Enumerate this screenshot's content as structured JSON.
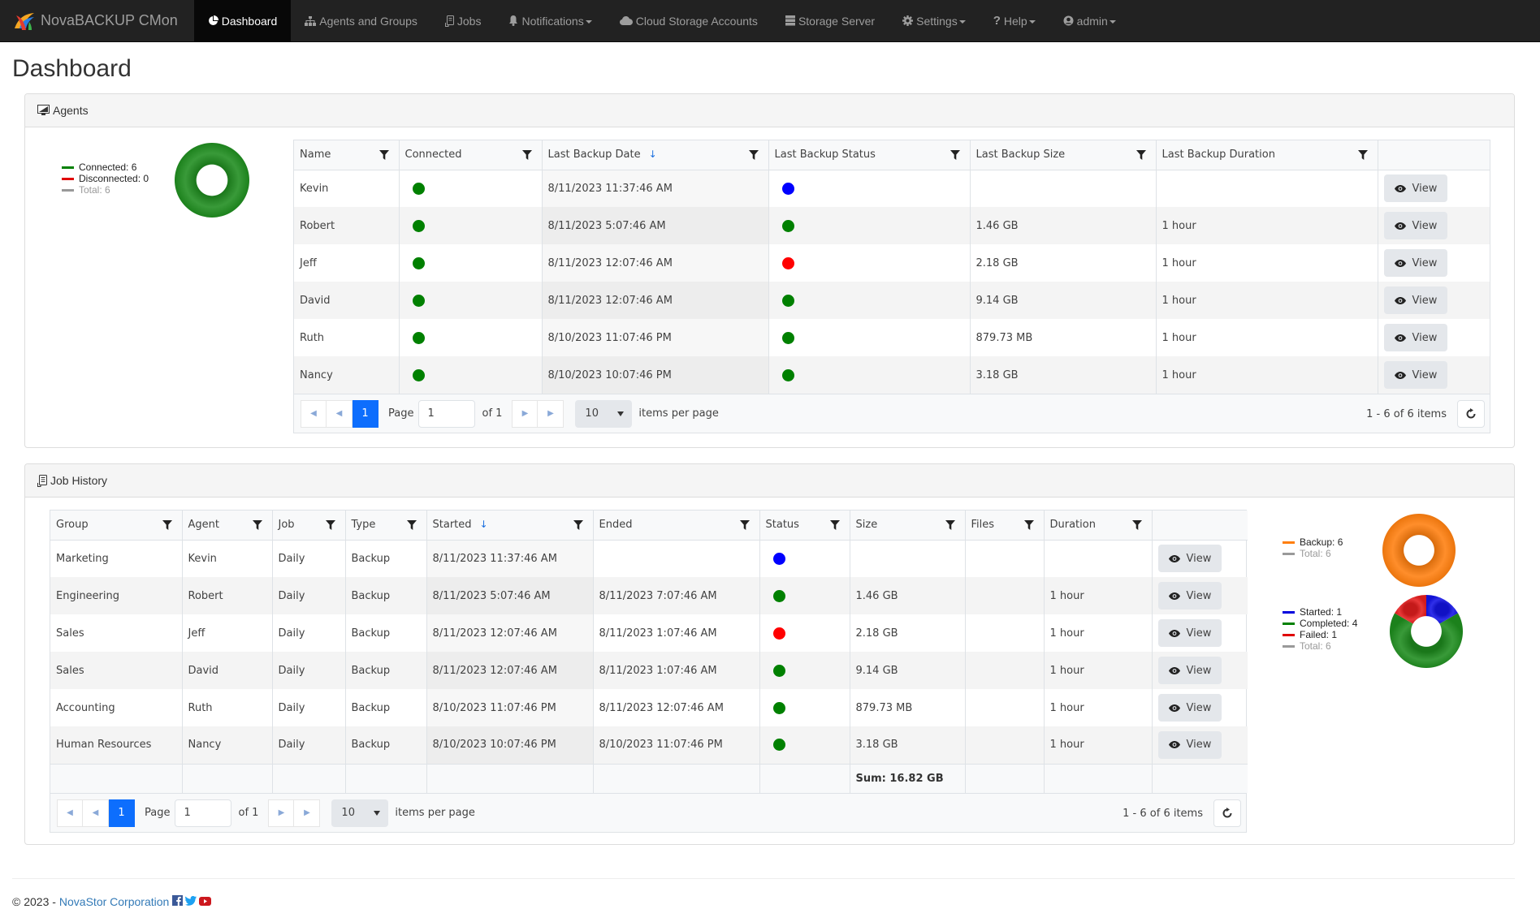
{
  "app": {
    "brand": "NovaBACKUP CMon"
  },
  "nav": {
    "items": [
      {
        "label": "Dashboard",
        "icon": "pie-chart-icon",
        "active": true
      },
      {
        "label": "Agents and Groups",
        "icon": "sitemap-icon"
      },
      {
        "label": "Jobs",
        "icon": "scroll-icon"
      },
      {
        "label": "Notifications",
        "icon": "bell-icon",
        "dropdown": true
      },
      {
        "label": "Cloud Storage Accounts",
        "icon": "cloud-icon"
      },
      {
        "label": "Storage Server",
        "icon": "server-icon"
      },
      {
        "label": "Settings",
        "icon": "gear-icon",
        "dropdown": true
      },
      {
        "label": "Help",
        "icon": "question-icon",
        "dropdown": true
      },
      {
        "label": "admin",
        "icon": "user-circle-icon",
        "dropdown": true
      }
    ]
  },
  "page": {
    "title": "Dashboard"
  },
  "agents": {
    "panel_title": "Agents",
    "chart": {
      "legend": [
        {
          "label": "Connected: 6",
          "color": "#008000"
        },
        {
          "label": "Disconnected: 0",
          "color": "#e00000"
        },
        {
          "label": "Total: 6",
          "color": "#999999"
        }
      ],
      "slices": [
        {
          "name": "Connected",
          "value": 6,
          "color": "#1e8c1e"
        },
        {
          "name": "Disconnected",
          "value": 0,
          "color": "#e02020"
        }
      ]
    },
    "columns": [
      "Name",
      "Connected",
      "Last Backup Date",
      "Last Backup Status",
      "Last Backup Size",
      "Last Backup Duration",
      ""
    ],
    "sorted_column": "Last Backup Date",
    "rows": [
      {
        "name": "Kevin",
        "connected": "green",
        "date": "8/11/2023 11:37:46 AM",
        "status": "blue",
        "size": "",
        "duration": ""
      },
      {
        "name": "Robert",
        "connected": "green",
        "date": "8/11/2023 5:07:46 AM",
        "status": "green",
        "size": "1.46 GB",
        "duration": "1 hour"
      },
      {
        "name": "Jeff",
        "connected": "green",
        "date": "8/11/2023 12:07:46 AM",
        "status": "red",
        "size": "2.18 GB",
        "duration": "1 hour"
      },
      {
        "name": "David",
        "connected": "green",
        "date": "8/11/2023 12:07:46 AM",
        "status": "green",
        "size": "9.14 GB",
        "duration": "1 hour"
      },
      {
        "name": "Ruth",
        "connected": "green",
        "date": "8/10/2023 11:07:46 PM",
        "status": "green",
        "size": "879.73 MB",
        "duration": "1 hour"
      },
      {
        "name": "Nancy",
        "connected": "green",
        "date": "8/10/2023 10:07:46 PM",
        "status": "green",
        "size": "3.18 GB",
        "duration": "1 hour"
      }
    ],
    "view_label": "View",
    "pager": {
      "current_page": "1",
      "page_label": "Page",
      "page_input": "1",
      "of_label": "of 1",
      "page_size": "10",
      "items_per_page": "items per page",
      "info": "1 - 6 of 6 items"
    }
  },
  "jobs": {
    "panel_title": "Job History",
    "columns": [
      "Group",
      "Agent",
      "Job",
      "Type",
      "Started",
      "Ended",
      "Status",
      "Size",
      "Files",
      "Duration",
      ""
    ],
    "sorted_column": "Started",
    "rows": [
      {
        "group": "Marketing",
        "agent": "Kevin",
        "job": "Daily",
        "type": "Backup",
        "started": "8/11/2023 11:37:46 AM",
        "ended": "",
        "status": "blue",
        "size": "",
        "files": "",
        "duration": ""
      },
      {
        "group": "Engineering",
        "agent": "Robert",
        "job": "Daily",
        "type": "Backup",
        "started": "8/11/2023 5:07:46 AM",
        "ended": "8/11/2023 7:07:46 AM",
        "status": "green",
        "size": "1.46 GB",
        "files": "",
        "duration": "1 hour"
      },
      {
        "group": "Sales",
        "agent": "Jeff",
        "job": "Daily",
        "type": "Backup",
        "started": "8/11/2023 12:07:46 AM",
        "ended": "8/11/2023 1:07:46 AM",
        "status": "red",
        "size": "2.18 GB",
        "files": "",
        "duration": "1 hour"
      },
      {
        "group": "Sales",
        "agent": "David",
        "job": "Daily",
        "type": "Backup",
        "started": "8/11/2023 12:07:46 AM",
        "ended": "8/11/2023 1:07:46 AM",
        "status": "green",
        "size": "9.14 GB",
        "files": "",
        "duration": "1 hour"
      },
      {
        "group": "Accounting",
        "agent": "Ruth",
        "job": "Daily",
        "type": "Backup",
        "started": "8/10/2023 11:07:46 PM",
        "ended": "8/11/2023 12:07:46 AM",
        "status": "green",
        "size": "879.73 MB",
        "files": "",
        "duration": "1 hour"
      },
      {
        "group": "Human Resources",
        "agent": "Nancy",
        "job": "Daily",
        "type": "Backup",
        "started": "8/10/2023 10:07:46 PM",
        "ended": "8/10/2023 11:07:46 PM",
        "status": "green",
        "size": "3.18 GB",
        "files": "",
        "duration": "1 hour"
      }
    ],
    "sum_label": "Sum: 16.82 GB",
    "view_label": "View",
    "pager": {
      "current_page": "1",
      "page_label": "Page",
      "page_input": "1",
      "of_label": "of 1",
      "page_size": "10",
      "items_per_page": "items per page",
      "info": "1 - 6 of 6 items"
    },
    "type_chart": {
      "legend": [
        {
          "label": "Backup: 6",
          "color": "#ff7f0e"
        },
        {
          "label": "Total: 6",
          "color": "#999999"
        }
      ],
      "slices": [
        {
          "name": "Backup",
          "value": 6,
          "color": "#ff7f0e"
        }
      ]
    },
    "status_chart": {
      "legend": [
        {
          "label": "Started: 1",
          "color": "#0000dd"
        },
        {
          "label": "Completed: 4",
          "color": "#008000"
        },
        {
          "label": "Failed: 1",
          "color": "#e00000"
        },
        {
          "label": "Total: 6",
          "color": "#999999"
        }
      ],
      "slices": [
        {
          "name": "Started",
          "value": 1,
          "color": "#1414e6"
        },
        {
          "name": "Completed",
          "value": 4,
          "color": "#1e8c1e"
        },
        {
          "name": "Failed",
          "value": 1,
          "color": "#e61e1e"
        }
      ]
    }
  },
  "status_colors": {
    "green": "#008000",
    "blue": "#0000ff",
    "red": "#ff0000"
  },
  "footer": {
    "copyright": "© 2023 -",
    "company": "NovaStor Corporation"
  }
}
